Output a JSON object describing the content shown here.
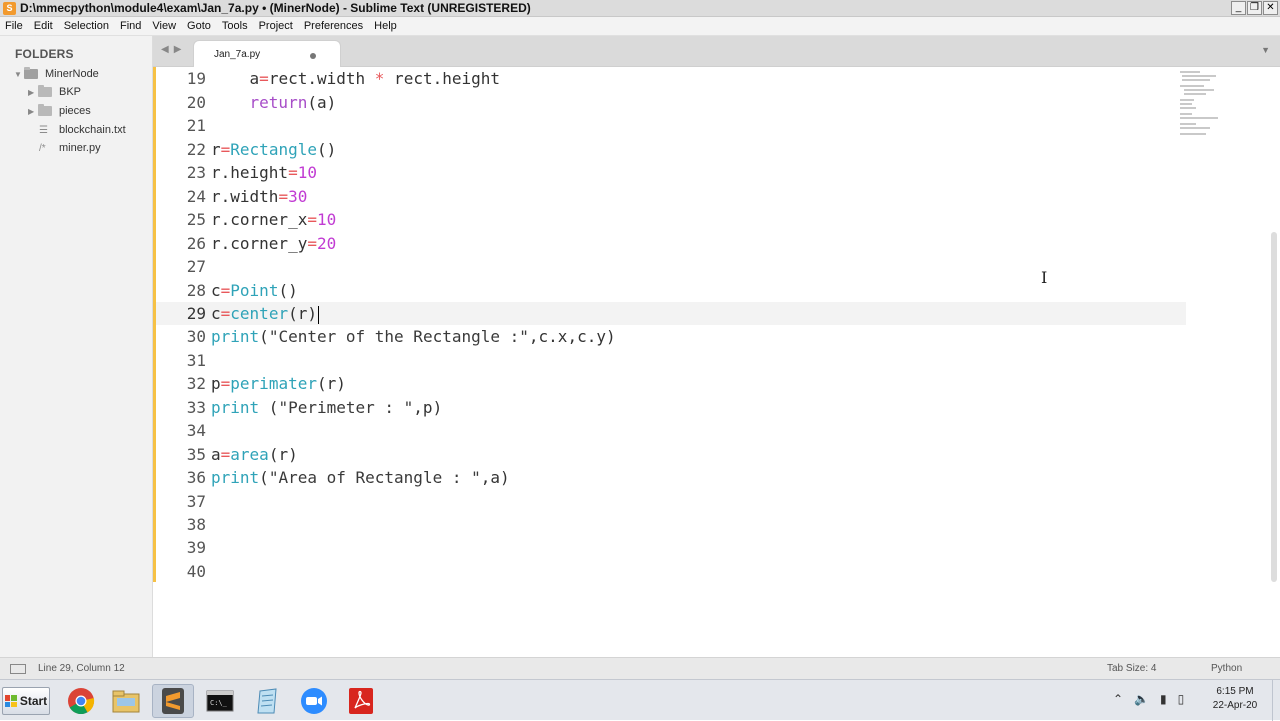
{
  "window": {
    "title": "D:\\mmecpython\\module4\\exam\\Jan_7a.py • (MinerNode) - Sublime Text (UNREGISTERED)",
    "controls": [
      "_",
      "❐",
      "✕"
    ]
  },
  "menu": [
    "File",
    "Edit",
    "Selection",
    "Find",
    "View",
    "Goto",
    "Tools",
    "Project",
    "Preferences",
    "Help"
  ],
  "sidebar": {
    "header": "FOLDERS",
    "root": "MinerNode",
    "items": [
      {
        "label": "BKP",
        "type": "folder"
      },
      {
        "label": "pieces",
        "type": "folder"
      },
      {
        "label": "blockchain.txt",
        "type": "file"
      },
      {
        "label": "miner.py",
        "type": "file"
      }
    ]
  },
  "tabs": [
    {
      "label": "Jan_7a.py",
      "modified": true,
      "active": true
    }
  ],
  "editor": {
    "first_line": 19,
    "current_line": 29,
    "line_numbers": [
      "19",
      "20",
      "21",
      "22",
      "23",
      "24",
      "25",
      "26",
      "27",
      "28",
      "29",
      "30",
      "31",
      "32",
      "33",
      "34",
      "35",
      "36",
      "37",
      "38",
      "39",
      "40"
    ]
  },
  "status": {
    "position": "Line 29, Column 12",
    "tab_size": "Tab Size: 4",
    "syntax": "Python"
  },
  "taskbar": {
    "start_label": "Start",
    "clock_time": "6:15 PM",
    "clock_date": "22-Apr-20",
    "apps": [
      "chrome-icon",
      "explorer-icon",
      "sublime-icon",
      "cmd-icon",
      "notepad-icon",
      "zoom-icon",
      "acrobat-icon"
    ]
  },
  "colors": {
    "keyword": "#a74dc8",
    "function": "#2fa3b8",
    "operator": "#e8585b",
    "number": "#c13bd3",
    "fold_marker": "#f6c145"
  }
}
